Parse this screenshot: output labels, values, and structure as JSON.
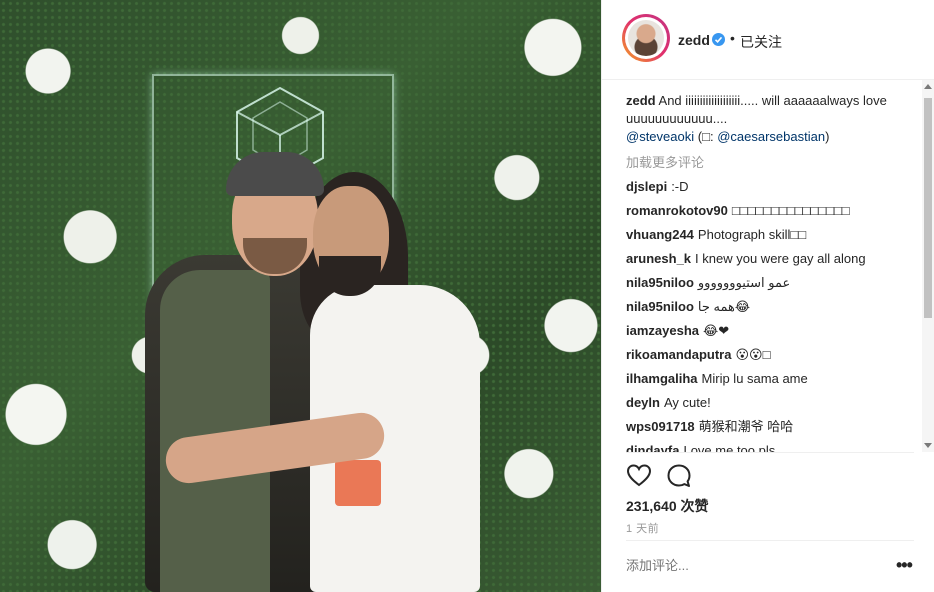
{
  "photo": {
    "alt": ""
  },
  "header": {
    "username": "zedd",
    "dot": "•",
    "follow_status": "已关注"
  },
  "caption": {
    "author": "zedd",
    "text": "And iiiiiiiiiiiiiiiiiii..... will aaaaaalways love uuuuuuuuuuuu....",
    "mention1": "@steveaoki",
    "paren_open": "(",
    "camera_glyph": "□",
    "colon": ":",
    "mention2": "@caesarsebastian",
    "paren_close": ")"
  },
  "load_more": "加载更多评论",
  "comments": [
    {
      "author": "djslepi",
      "text": ":-D"
    },
    {
      "author": "romanrokotov90",
      "text": "□□□□□□□□□□□□□□□"
    },
    {
      "author": "vhuang244",
      "text": "Photograph skill□□"
    },
    {
      "author": "arunesh_k",
      "text": "I knew you were gay all along"
    },
    {
      "author": "nila95niloo",
      "text": "عمو استیووووووو"
    },
    {
      "author": "nila95niloo",
      "text": "همه جا😂"
    },
    {
      "author": "iamzayesha",
      "text": "😂❤"
    },
    {
      "author": "rikoamandaputra",
      "text": "😮😮□"
    },
    {
      "author": "ilhamgaliha",
      "text": "Mirip lu sama ame"
    },
    {
      "author": "deyln",
      "text": "Ay cute!"
    },
    {
      "author": "wps091718",
      "text": "萌猴和潮爷 哈哈"
    },
    {
      "author": "dindayfa",
      "text": "Love me too pls"
    }
  ],
  "likes": "231,640 次赞",
  "timestamp": "1 天前",
  "add_comment": {
    "placeholder": "添加评论..."
  },
  "more": "•••",
  "colors": {
    "verified": "#3897f0",
    "mention": "#003569",
    "muted": "#999999",
    "text": "#262626"
  },
  "icons": [
    "verified-icon",
    "heart-icon",
    "comment-bubble-icon",
    "more-options-icon",
    "neon-logo"
  ]
}
